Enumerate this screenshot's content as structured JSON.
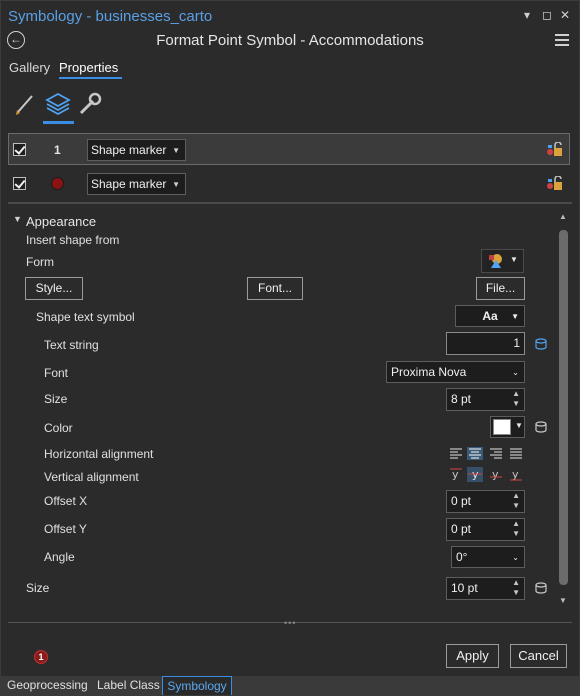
{
  "window": {
    "title": "Symbology - businesses_carto",
    "controls": [
      "▾",
      "◻",
      "✕"
    ]
  },
  "header": {
    "title": "Format Point Symbol - Accommodations",
    "back_icon": "back-arrow-icon",
    "menu_icon": "hamburger-menu-icon"
  },
  "tabs": [
    {
      "label": "Gallery",
      "active": false
    },
    {
      "label": "Properties",
      "active": true
    }
  ],
  "subtabs": [
    {
      "icon": "paintbrush-icon",
      "active": false
    },
    {
      "icon": "layers-icon",
      "active": true
    },
    {
      "icon": "wrench-icon",
      "active": false
    }
  ],
  "layers": [
    {
      "checked": true,
      "preview": "1",
      "type": "Shape marker",
      "selected": true
    },
    {
      "checked": true,
      "preview": "red-circle",
      "type": "Shape marker",
      "selected": false
    }
  ],
  "appearance": {
    "section_label": "Appearance",
    "insert_label": "Insert shape from",
    "form_label": "Form",
    "style_button": "Style...",
    "font_button": "Font...",
    "file_button": "File...",
    "shape_text_label": "Shape text symbol",
    "shape_text_value": "Aa",
    "text_string_label": "Text string",
    "text_string_value": "1",
    "font_label": "Font",
    "font_value": "Proxima Nova",
    "size_label": "Size",
    "size_value": "8 pt",
    "color_label": "Color",
    "color_value": "#ffffff",
    "halign_label": "Horizontal alignment",
    "valign_label": "Vertical alignment",
    "offset_x_label": "Offset X",
    "offset_x_value": "0 pt",
    "offset_y_label": "Offset Y",
    "offset_y_value": "0 pt",
    "angle_label": "Angle",
    "angle_value": "0°",
    "outer_size_label": "Size",
    "outer_size_value": "10 pt"
  },
  "footer": {
    "error_count": "1",
    "apply_label": "Apply",
    "cancel_label": "Cancel"
  },
  "bottom_tabs": [
    {
      "label": "Geoprocessing",
      "active": false
    },
    {
      "label": "Label Class",
      "active": false
    },
    {
      "label": "Symbology",
      "active": true
    }
  ],
  "colors": {
    "accent": "#3a8ee6",
    "title": "#5aa0e6",
    "background": "#2b2b2b"
  }
}
